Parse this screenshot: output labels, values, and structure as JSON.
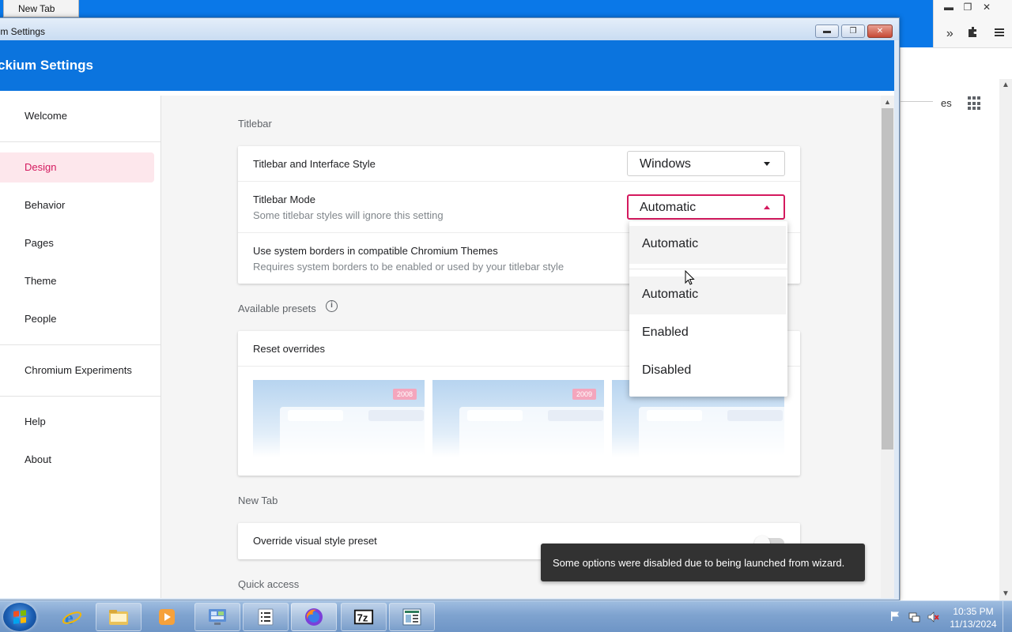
{
  "background_browser": {
    "tab_title": "New Tab",
    "partial_text": "es",
    "controls": [
      "▬",
      "❐",
      "✕"
    ]
  },
  "window": {
    "title": "ium Settings",
    "app_title": "ckium Settings",
    "accent_color": "#0b74de",
    "highlight_color": "#d4195e"
  },
  "sidebar": {
    "items": [
      {
        "label": "Welcome"
      },
      {
        "label": "Design",
        "active": true
      },
      {
        "label": "Behavior"
      },
      {
        "label": "Pages"
      },
      {
        "label": "Theme"
      },
      {
        "label": "People"
      },
      {
        "label": "Chromium Experiments"
      },
      {
        "label": "Help"
      },
      {
        "label": "About"
      }
    ]
  },
  "titlebar_section": {
    "label": "Titlebar",
    "style_row": {
      "title": "Titlebar and Interface Style",
      "value": "Windows"
    },
    "mode_row": {
      "title": "Titlebar Mode",
      "subtitle": "Some titlebar styles will ignore this setting",
      "value": "Automatic"
    },
    "borders_row": {
      "title": "Use system borders in compatible Chromium Themes",
      "subtitle": "Requires system borders to be enabled or used by your titlebar style"
    }
  },
  "presets_section": {
    "label": "Available presets",
    "reset_label": "Reset overrides",
    "presets": [
      {
        "badge": "2008"
      },
      {
        "badge": "2009"
      },
      {
        "badge": ""
      }
    ]
  },
  "newtab_section": {
    "label": "New Tab",
    "override_row": {
      "title": "Override visual style preset",
      "enabled": false
    }
  },
  "quick_access_section": {
    "label": "Quick access"
  },
  "dropdown": {
    "options": [
      "Automatic",
      "Automatic",
      "Enabled",
      "Disabled"
    ]
  },
  "toast": {
    "message": "Some options were disabled due to being launched from wizard."
  },
  "taskbar": {
    "apps": [
      "internet-explorer",
      "file-explorer",
      "media-player",
      "control-panel",
      "notes",
      "firefox",
      "7zip",
      "document"
    ],
    "clock": {
      "time": "10:35 PM",
      "date": "11/13/2024"
    }
  }
}
